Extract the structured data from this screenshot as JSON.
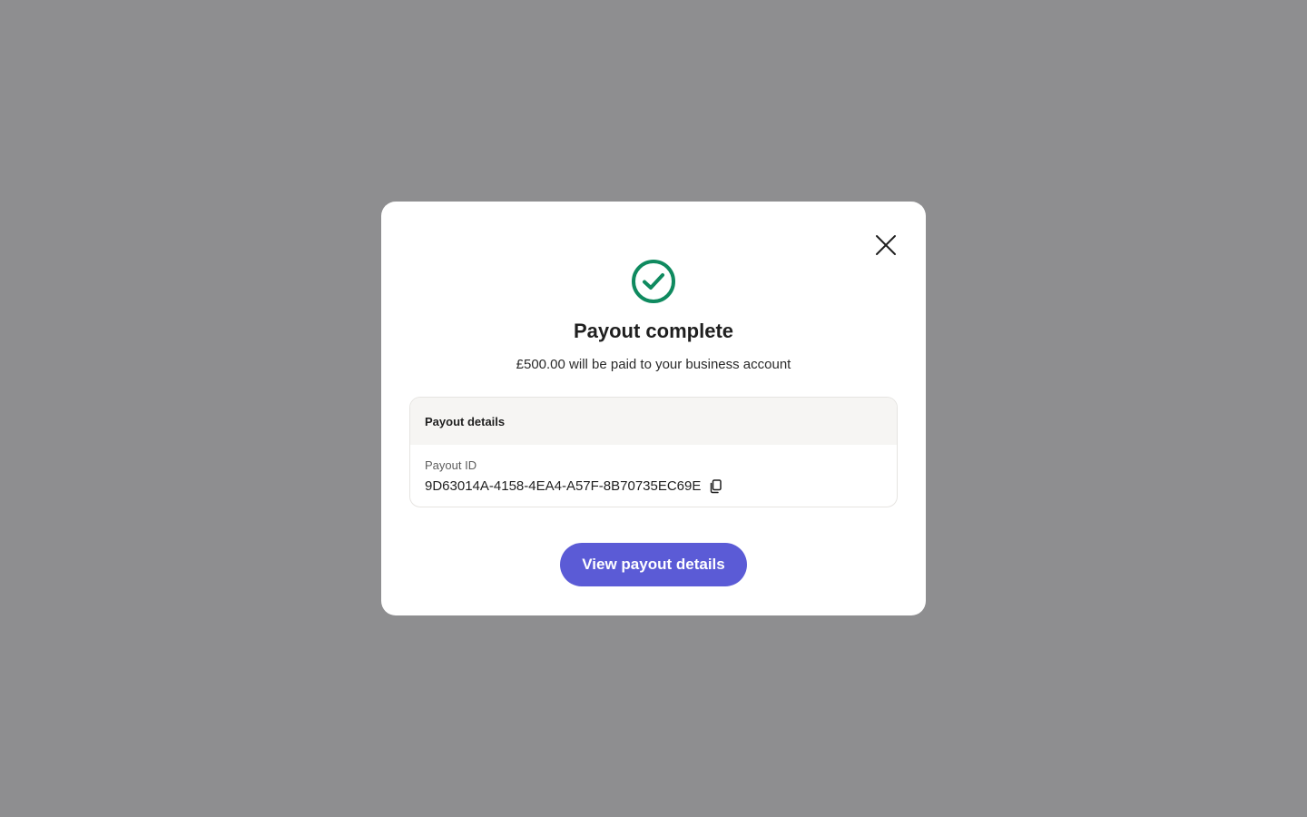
{
  "modal": {
    "title": "Payout complete",
    "subtitle": "£500.00 will be paid to your business account",
    "icons": {
      "success": "check-circle-icon",
      "close": "close-icon",
      "copy": "copy-icon"
    },
    "details": {
      "header": "Payout details",
      "payout_id_label": "Payout ID",
      "payout_id_value": "9D63014A-4158-4EA4-A57F-8B70735EC69E"
    },
    "primary_button_label": "View payout details"
  },
  "colors": {
    "overlay": "#8e8e90",
    "success": "#0f8a5f",
    "primary": "#5b5bd6",
    "details_header_bg": "#f6f5f3"
  }
}
